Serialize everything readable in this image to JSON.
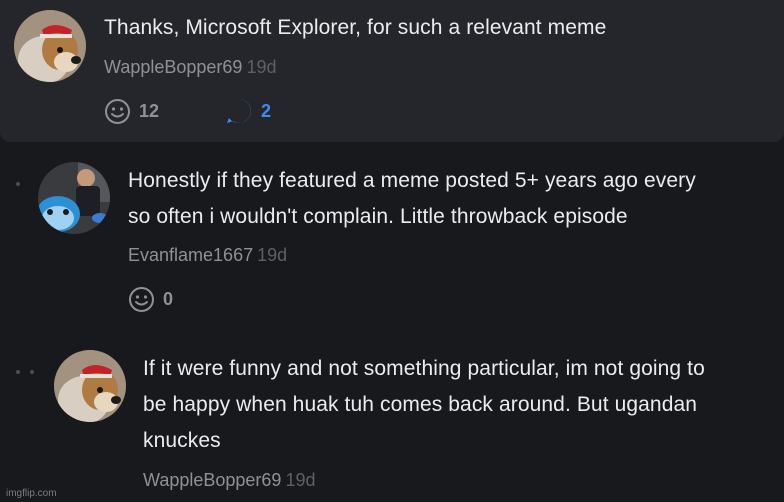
{
  "comments": [
    {
      "text": "Thanks, Microsoft Explorer, for such a relevant meme",
      "author": "WappleBopper69",
      "time": "19d",
      "upvotes": "12",
      "replies": "2",
      "avatar": "dog-with-red-cap"
    },
    {
      "text_lines": [
        "Honestly if they featured a meme posted 5+ years ago every",
        "so often i wouldn't complain. Little throwback episode"
      ],
      "author": "Evanflame1667",
      "time": "19d",
      "upvotes": "0",
      "avatar": "person-with-blue-cartoon"
    },
    {
      "text_lines": [
        "If it were funny and not something particular, im not going to",
        "be happy when huak tuh comes back around. But ugandan",
        "knuckes"
      ],
      "author": "WappleBopper69",
      "time": "19d",
      "avatar": "dog-with-red-cap"
    }
  ],
  "watermark": "imgflip.com",
  "colors": {
    "background": "#18191d",
    "highlight_card": "#25262b",
    "accent_blue": "#3b8df2",
    "muted": "#8f9197"
  },
  "icons": [
    "smiley-upvote-icon",
    "reply-arrow-icon"
  ]
}
